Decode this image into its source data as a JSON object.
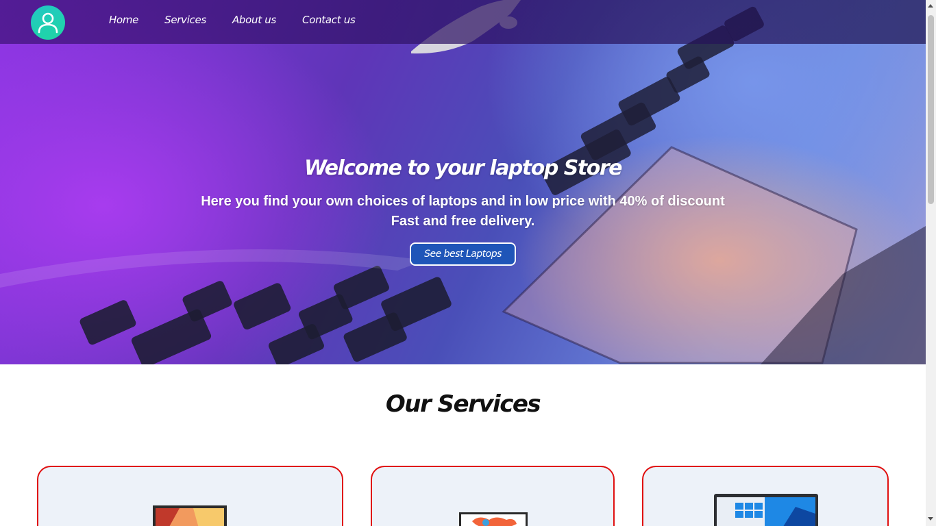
{
  "nav": {
    "links": [
      "Home",
      "Services",
      "About us",
      "Contact us"
    ]
  },
  "hero": {
    "title": "Welcome to your laptop Store",
    "subtitle_line1": "Here you find your own choices of laptops and in low price with 40% of discount",
    "subtitle_line2": "Fast and free delivery.",
    "button_label": "See best Laptops"
  },
  "services": {
    "title": "Our Services"
  },
  "colors": {
    "accent": "#1f55b8",
    "card_border": "#e01010",
    "card_bg": "#edf2f9",
    "logo": "#23c7c4"
  },
  "icons": {
    "logo": "user-icon"
  }
}
